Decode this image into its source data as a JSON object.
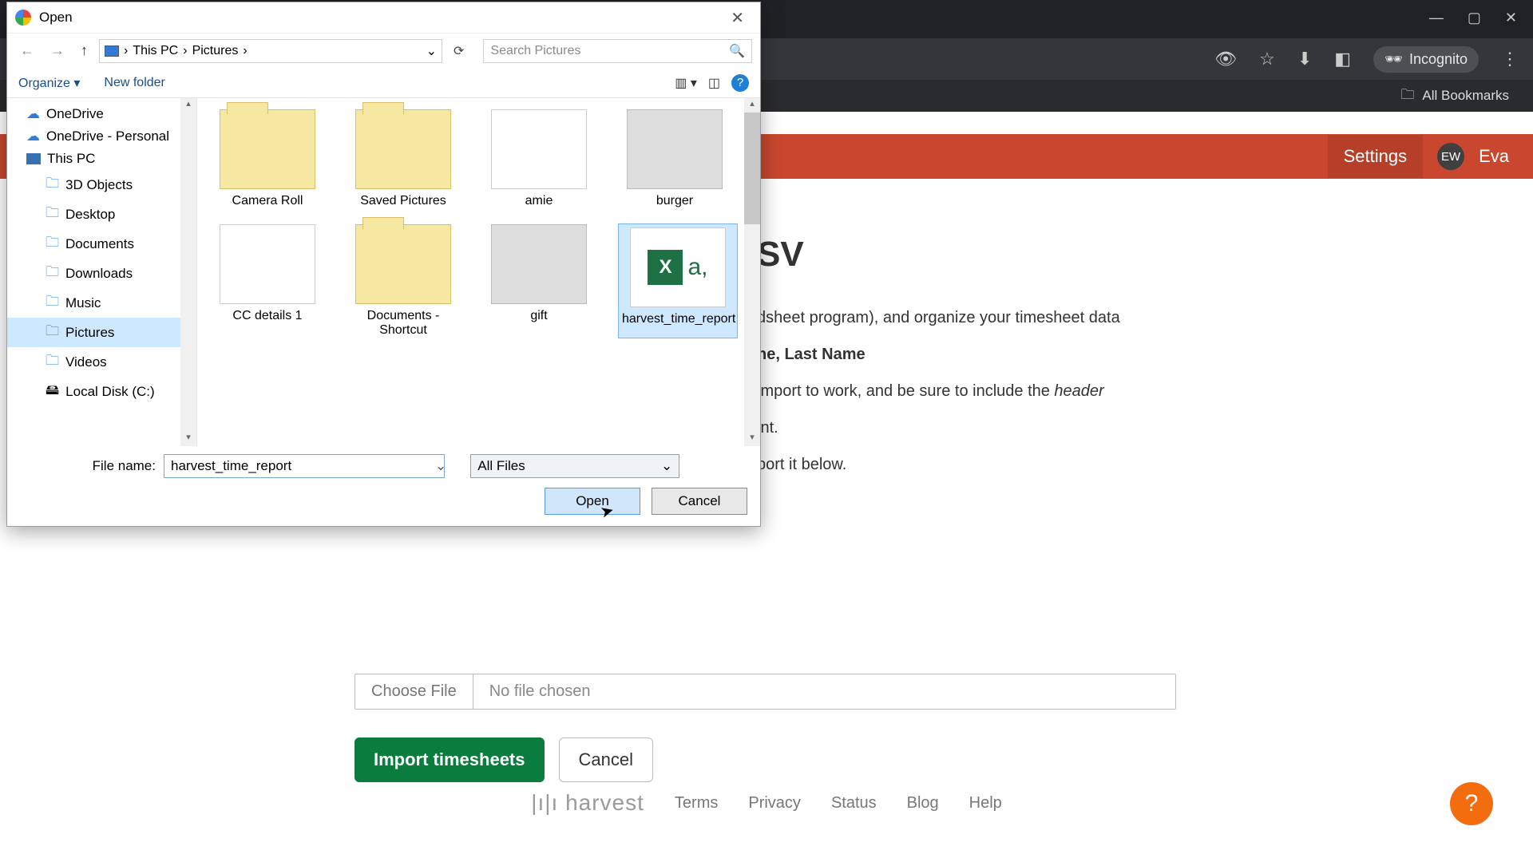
{
  "browser": {
    "minimize_icon": "—",
    "maximize_icon": "▢",
    "close_icon": "✕",
    "eye_icon": "👁",
    "star_icon": "☆",
    "download_icon": "⬇",
    "panel_icon": "◧",
    "incognito_label": "Incognito",
    "menu_icon": "⋮",
    "bookmarks_icon": "🗀",
    "bookmarks_label": "All Bookmarks"
  },
  "harvest": {
    "settings": "Settings",
    "avatar_initials": "EW",
    "user_name": "Eva"
  },
  "page": {
    "heading_suffix": "SV",
    "desc_line1": "dsheet program), and organize your timesheet data",
    "sub_heading": "ne, Last Name",
    "desc_line2a": "import to work, and be sure to include the ",
    "desc_line2_em": "header",
    "desc_line2b": "int.",
    "desc_line3": "port it below.",
    "choose_file": "Choose File",
    "no_file": "No file chosen",
    "import_btn": "Import timesheets",
    "cancel_btn": "Cancel"
  },
  "footer": {
    "logo": "harvest",
    "links": [
      "Terms",
      "Privacy",
      "Status",
      "Blog",
      "Help"
    ]
  },
  "help_fab": "?",
  "dialog": {
    "title": "Open",
    "close": "✕",
    "nav_back": "←",
    "nav_fwd": "→",
    "nav_up": "↑",
    "path_segments": [
      "This PC",
      "Pictures"
    ],
    "path_sep": "›",
    "dropdown": "⌄",
    "refresh": "⟳",
    "search_placeholder": "Search Pictures",
    "search_icon": "🔍",
    "organize": "Organize ▾",
    "new_folder": "New folder",
    "view_icon": "▥ ▾",
    "preview_icon": "◫",
    "help_icon": "?",
    "tree": [
      {
        "label": "OneDrive",
        "icon": "cloud",
        "indent": false
      },
      {
        "label": "OneDrive - Personal",
        "icon": "cloud",
        "indent": false
      },
      {
        "label": "This PC",
        "icon": "pc",
        "indent": false
      },
      {
        "label": "3D Objects",
        "icon": "folder",
        "indent": true
      },
      {
        "label": "Desktop",
        "icon": "folder",
        "indent": true
      },
      {
        "label": "Documents",
        "icon": "folder",
        "indent": true
      },
      {
        "label": "Downloads",
        "icon": "folder",
        "indent": true
      },
      {
        "label": "Music",
        "icon": "folder",
        "indent": true
      },
      {
        "label": "Pictures",
        "icon": "folder",
        "indent": true,
        "selected": true
      },
      {
        "label": "Videos",
        "icon": "folder",
        "indent": true
      },
      {
        "label": "Local Disk (C:)",
        "icon": "disk",
        "indent": true
      }
    ],
    "files": [
      {
        "label": "Camera Roll",
        "type": "folder"
      },
      {
        "label": "Saved Pictures",
        "type": "folder"
      },
      {
        "label": "amie",
        "type": "white"
      },
      {
        "label": "burger",
        "type": "img"
      },
      {
        "label": "CC details 1",
        "type": "white"
      },
      {
        "label": "Documents - Shortcut",
        "type": "folder"
      },
      {
        "label": "gift",
        "type": "img"
      },
      {
        "label": "harvest_time_report",
        "type": "csv",
        "selected": true
      }
    ],
    "filename_label": "File name:",
    "filename_value": "harvest_time_report",
    "filter_value": "All Files",
    "open_btn": "Open",
    "cancel_btn": "Cancel"
  }
}
